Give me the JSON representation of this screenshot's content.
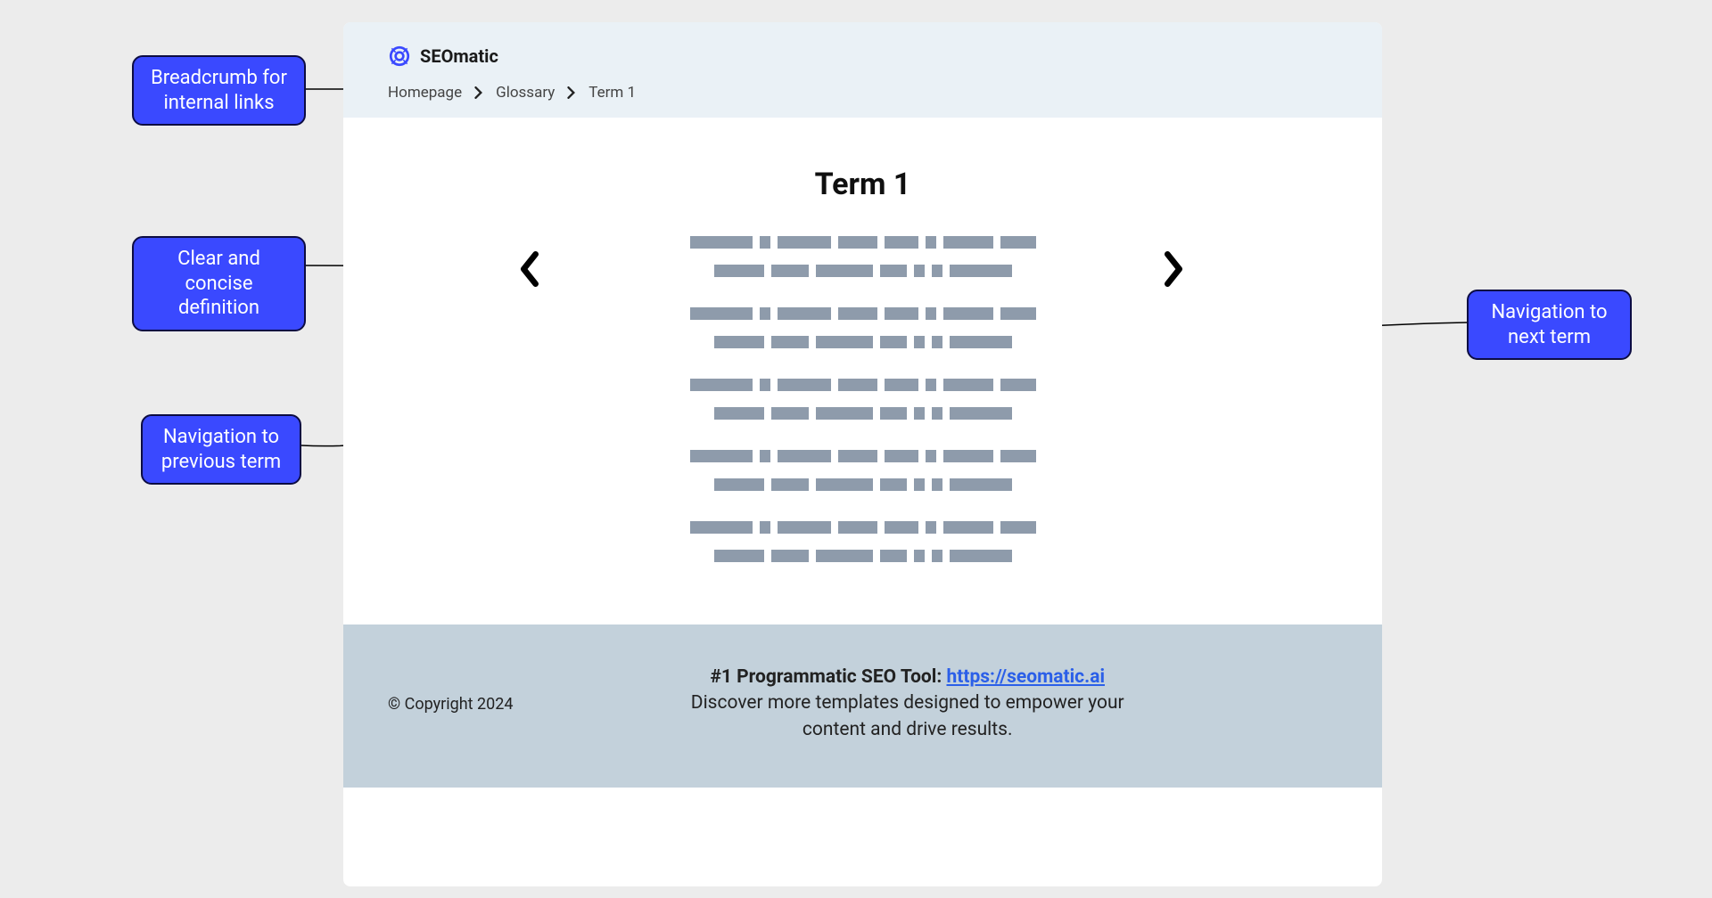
{
  "logo": {
    "text": "SEOmatic"
  },
  "breadcrumb": {
    "items": [
      "Homepage",
      "Glossary",
      "Term 1"
    ]
  },
  "page": {
    "term_title": "Term 1"
  },
  "footer": {
    "copyright": "© Copyright 2024",
    "tool_label": "#1 Programmatic SEO Tool:",
    "tool_url": "https://seomatic.ai",
    "tagline_1": "Discover more templates designed to empower your",
    "tagline_2": "content and drive results."
  },
  "callouts": {
    "breadcrumb": "Breadcrumb for internal links",
    "definition": "Clear and concise definition",
    "prev_nav": "Navigation to previous term",
    "next_nav": "Navigation to next term"
  }
}
